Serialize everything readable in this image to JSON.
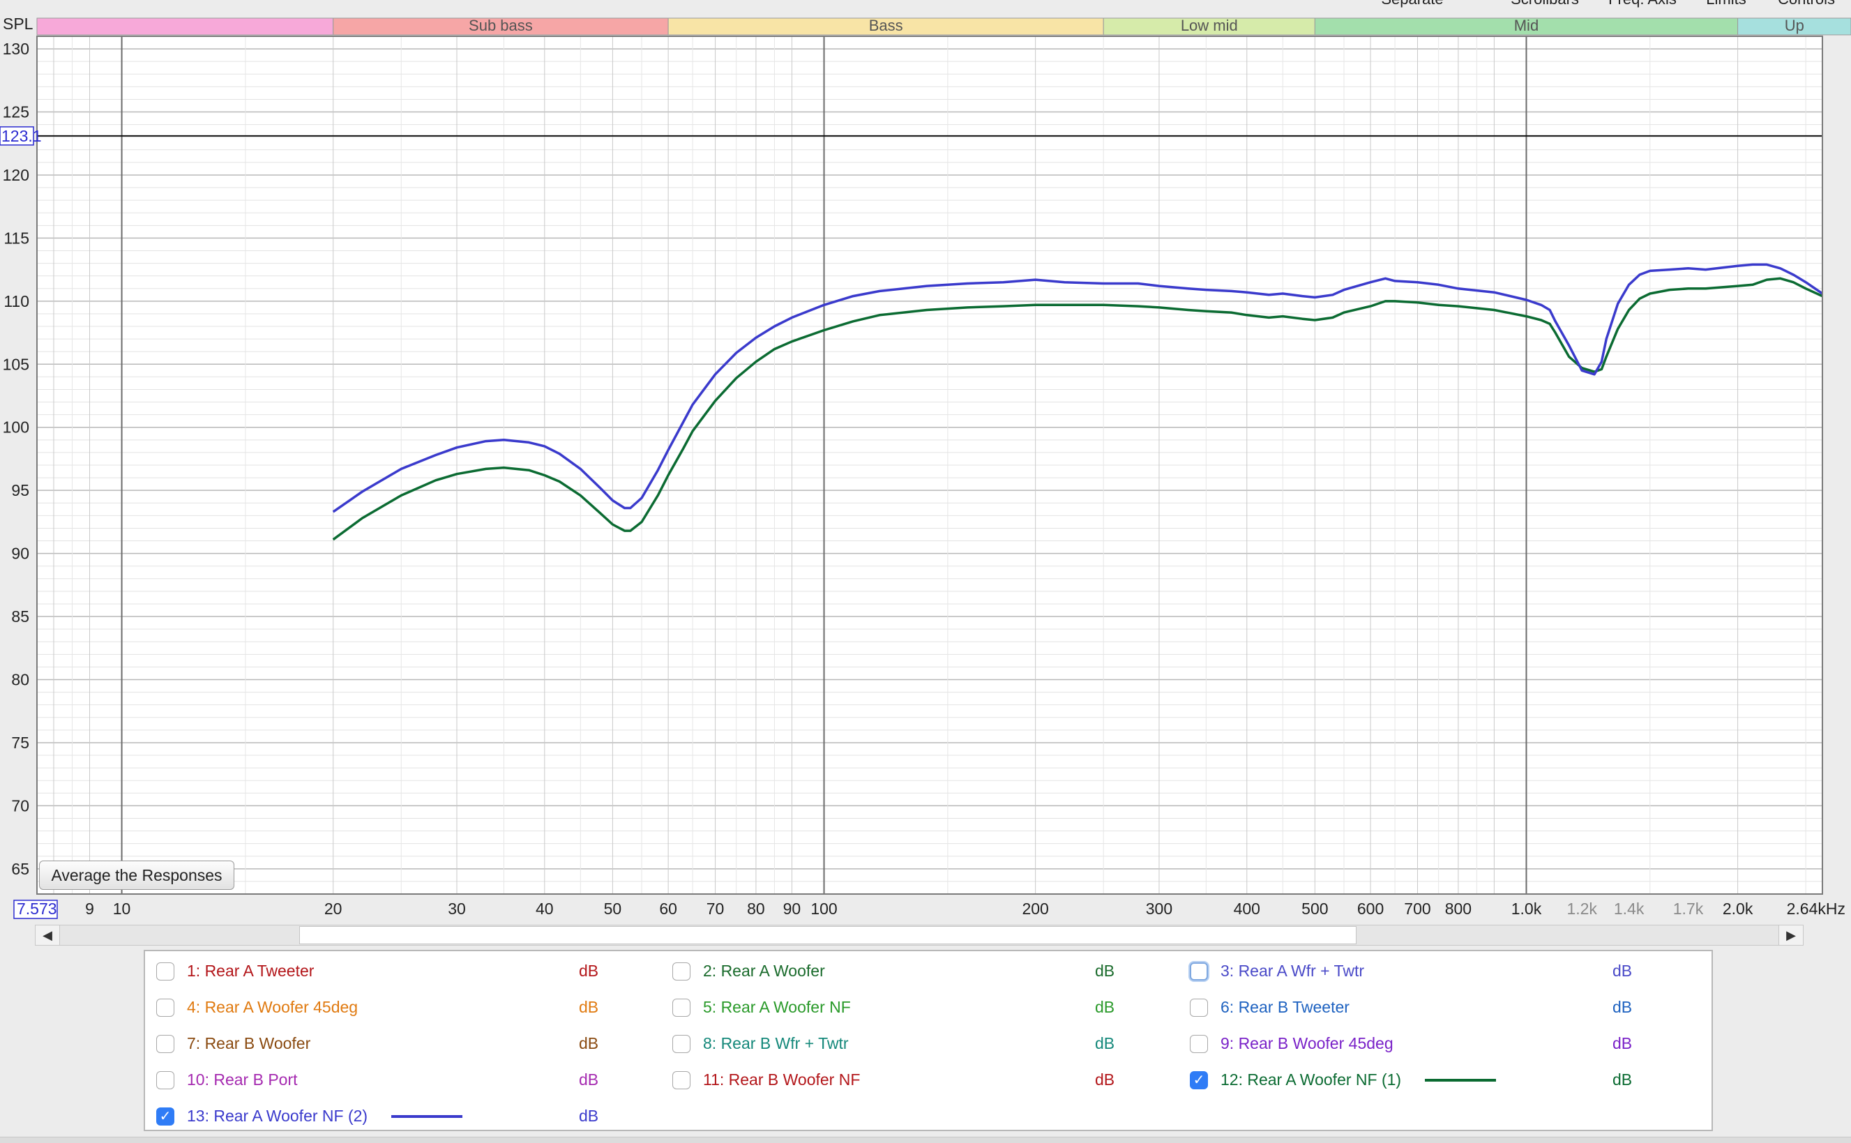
{
  "bands": [
    {
      "label": "",
      "from": 5,
      "to": 20,
      "color": "#f7a9d9"
    },
    {
      "label": "Sub bass",
      "from": 20,
      "to": 60,
      "color": "#f6a6a6"
    },
    {
      "label": "Bass",
      "from": 60,
      "to": 250,
      "color": "#f8e4a6"
    },
    {
      "label": "Low mid",
      "from": 250,
      "to": 500,
      "color": "#d6ebaa"
    },
    {
      "label": "Mid",
      "from": 500,
      "to": 2000,
      "color": "#a3dfac"
    },
    {
      "label": "Up",
      "from": 2000,
      "to": 4000,
      "color": "#a6e0de"
    }
  ],
  "top_cut_labels": [
    "Separate",
    "Scrollbars",
    "Freq. Axis",
    "Limits",
    "Controls"
  ],
  "controls": {
    "average_button": "Average the Responses",
    "scroll_left": "◀",
    "scroll_right": "▶"
  },
  "legend": [
    {
      "label": "1: Rear A Tweeter",
      "unit": "dB",
      "color": "#b3161a",
      "checked": false
    },
    {
      "label": "2: Rear A Woofer",
      "unit": "dB",
      "color": "#1a6b2c",
      "checked": false
    },
    {
      "label": "3: Rear A Wfr + Twtr",
      "unit": "dB",
      "color": "#4a4ac8",
      "checked": false,
      "focused": true
    },
    {
      "label": "4: Rear A Woofer 45deg",
      "unit": "dB",
      "color": "#e07a10",
      "checked": false
    },
    {
      "label": "5: Rear A Woofer NF",
      "unit": "dB",
      "color": "#2a9a2a",
      "checked": false
    },
    {
      "label": "6: Rear B Tweeter",
      "unit": "dB",
      "color": "#1e62c0",
      "checked": false
    },
    {
      "label": "7: Rear B Woofer",
      "unit": "dB",
      "color": "#8a4a10",
      "checked": false
    },
    {
      "label": "8: Rear B Wfr + Twtr",
      "unit": "dB",
      "color": "#14887a",
      "checked": false
    },
    {
      "label": "9: Rear B Woofer 45deg",
      "unit": "dB",
      "color": "#7a22c8",
      "checked": false
    },
    {
      "label": "10: Rear B Port",
      "unit": "dB",
      "color": "#a52ab0",
      "checked": false
    },
    {
      "label": "11: Rear B Woofer NF",
      "unit": "dB",
      "color": "#b3161a",
      "checked": false
    },
    {
      "label": "12: Rear A Woofer NF (1)",
      "unit": "dB",
      "color": "#0b6b32",
      "checked": true,
      "line": true
    },
    {
      "label": "13: Rear A Woofer NF (2)",
      "unit": "dB",
      "color": "#3a3acc",
      "checked": true,
      "line": true
    }
  ],
  "chart_data": {
    "type": "line",
    "title": "",
    "ylabel": "SPL",
    "xlabel": "",
    "x_scale": "log",
    "xlim": [
      7.573,
      2640
    ],
    "ylim": [
      63,
      131
    ],
    "cursor_y": 123.1,
    "cursor_y_label": "123.1",
    "x_start_label": "7.573",
    "grid": true,
    "y_ticks": [
      65,
      70,
      75,
      80,
      85,
      90,
      95,
      100,
      105,
      110,
      115,
      120,
      125,
      130
    ],
    "x_tick_labels": [
      {
        "v": 9,
        "t": "9"
      },
      {
        "v": 10,
        "t": "10"
      },
      {
        "v": 20,
        "t": "20"
      },
      {
        "v": 30,
        "t": "30"
      },
      {
        "v": 40,
        "t": "40"
      },
      {
        "v": 50,
        "t": "50"
      },
      {
        "v": 60,
        "t": "60"
      },
      {
        "v": 70,
        "t": "70"
      },
      {
        "v": 80,
        "t": "80"
      },
      {
        "v": 90,
        "t": "90"
      },
      {
        "v": 100,
        "t": "100"
      },
      {
        "v": 200,
        "t": "200"
      },
      {
        "v": 300,
        "t": "300"
      },
      {
        "v": 400,
        "t": "400"
      },
      {
        "v": 500,
        "t": "500"
      },
      {
        "v": 600,
        "t": "600"
      },
      {
        "v": 700,
        "t": "700"
      },
      {
        "v": 800,
        "t": "800"
      },
      {
        "v": 1000,
        "t": "1.0k"
      },
      {
        "v": 1200,
        "t": "1.2k",
        "minor": true
      },
      {
        "v": 1400,
        "t": "1.4k",
        "minor": true
      },
      {
        "v": 1700,
        "t": "1.7k",
        "minor": true
      },
      {
        "v": 2000,
        "t": "2.0k"
      },
      {
        "v": 2640,
        "t": "2.64kHz"
      }
    ],
    "series": [
      {
        "name": "13: Rear A Woofer NF (2)",
        "color": "#3a3acc",
        "x": [
          20,
          22,
          25,
          28,
          30,
          33,
          35,
          38,
          40,
          42,
          45,
          48,
          50,
          52,
          53,
          55,
          58,
          60,
          63,
          65,
          70,
          75,
          80,
          85,
          90,
          100,
          110,
          120,
          140,
          160,
          180,
          200,
          220,
          250,
          280,
          300,
          330,
          350,
          380,
          400,
          430,
          450,
          480,
          500,
          530,
          550,
          600,
          630,
          650,
          700,
          750,
          800,
          900,
          1000,
          1050,
          1080,
          1100,
          1150,
          1200,
          1250,
          1280,
          1300,
          1350,
          1400,
          1450,
          1500,
          1600,
          1700,
          1800,
          2000,
          2100,
          2200,
          2300,
          2400,
          2500,
          2640
        ],
        "y": [
          93.3,
          94.9,
          96.7,
          97.8,
          98.4,
          98.9,
          99.0,
          98.8,
          98.5,
          97.9,
          96.7,
          95.2,
          94.2,
          93.6,
          93.6,
          94.4,
          96.6,
          98.2,
          100.4,
          101.8,
          104.2,
          105.9,
          107.1,
          108.0,
          108.7,
          109.7,
          110.4,
          110.8,
          111.2,
          111.4,
          111.5,
          111.7,
          111.5,
          111.4,
          111.4,
          111.2,
          111.0,
          110.9,
          110.8,
          110.7,
          110.5,
          110.6,
          110.4,
          110.3,
          110.5,
          110.9,
          111.5,
          111.8,
          111.6,
          111.5,
          111.3,
          111.0,
          110.7,
          110.1,
          109.7,
          109.3,
          108.4,
          106.5,
          104.5,
          104.2,
          105.2,
          107.0,
          109.8,
          111.3,
          112.1,
          112.4,
          112.5,
          112.6,
          112.5,
          112.8,
          112.9,
          112.9,
          112.6,
          112.1,
          111.5,
          110.6
        ]
      },
      {
        "name": "12: Rear A Woofer NF (1)",
        "color": "#0b6b32",
        "x": [
          20,
          22,
          25,
          28,
          30,
          33,
          35,
          38,
          40,
          42,
          45,
          48,
          50,
          52,
          53,
          55,
          58,
          60,
          63,
          65,
          70,
          75,
          80,
          85,
          90,
          100,
          110,
          120,
          140,
          160,
          180,
          200,
          220,
          250,
          280,
          300,
          330,
          350,
          380,
          400,
          430,
          450,
          480,
          500,
          530,
          550,
          600,
          630,
          650,
          700,
          750,
          800,
          900,
          1000,
          1050,
          1080,
          1100,
          1150,
          1200,
          1250,
          1280,
          1300,
          1350,
          1400,
          1450,
          1500,
          1600,
          1700,
          1800,
          2000,
          2100,
          2200,
          2300,
          2400,
          2500,
          2640
        ],
        "y": [
          91.1,
          92.8,
          94.6,
          95.8,
          96.3,
          96.7,
          96.8,
          96.6,
          96.2,
          95.7,
          94.6,
          93.2,
          92.3,
          91.8,
          91.8,
          92.5,
          94.6,
          96.2,
          98.3,
          99.7,
          102.1,
          103.9,
          105.2,
          106.2,
          106.8,
          107.7,
          108.4,
          108.9,
          109.3,
          109.5,
          109.6,
          109.7,
          109.7,
          109.7,
          109.6,
          109.5,
          109.3,
          109.2,
          109.1,
          108.9,
          108.7,
          108.8,
          108.6,
          108.5,
          108.7,
          109.1,
          109.6,
          110.0,
          110.0,
          109.9,
          109.7,
          109.6,
          109.3,
          108.8,
          108.5,
          108.2,
          107.5,
          105.6,
          104.7,
          104.4,
          104.6,
          105.6,
          107.8,
          109.3,
          110.2,
          110.6,
          110.9,
          111.0,
          111.0,
          111.2,
          111.3,
          111.7,
          111.8,
          111.5,
          111.0,
          110.4
        ]
      }
    ]
  }
}
